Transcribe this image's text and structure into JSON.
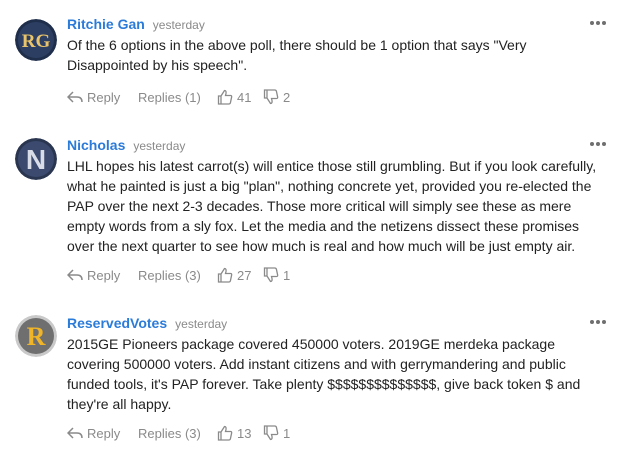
{
  "comments": [
    {
      "author": "Ritchie Gan",
      "time": "yesterday",
      "avatar_text": "RG",
      "text": "Of the 6 options in the above poll, there should be 1 option that says \"Very Disappointed by his speech\".",
      "reply_label": "Reply",
      "replies_label": "Replies (1)",
      "likes": "41",
      "dislikes": "2"
    },
    {
      "author": "Nicholas",
      "time": "yesterday",
      "avatar_text": "N",
      "text": "LHL hopes his latest carrot(s) will entice those still grumbling. But if you look carefully, what he painted is just a big \"plan\", nothing concrete yet, provided you re-elected the PAP over the next 2-3 decades. Those more critical will simply see these as mere empty words from a sly fox. Let the media and the netizens dissect these promises over the next quarter to see how much is real and how much will be just empty air.",
      "reply_label": "Reply",
      "replies_label": "Replies (3)",
      "likes": "27",
      "dislikes": "1"
    },
    {
      "author": "ReservedVotes",
      "time": "yesterday",
      "avatar_text": "R",
      "text": "2015GE Pioneers package covered 450000 voters. 2019GE merdeka package covering 500000 voters. Add instant citizens and with gerrymandering and public funded tools, it's PAP forever. Take plenty $$$$$$$$$$$$$$, give back token $ and they're all happy.",
      "reply_label": "Reply",
      "replies_label": "Replies (3)",
      "likes": "13",
      "dislikes": "1"
    }
  ],
  "colors": {
    "author": "#2b7bd9",
    "muted": "#8a8a8a",
    "text": "#222222"
  },
  "icons": [
    "reply-arrow-icon",
    "thumbs-up-icon",
    "thumbs-down-icon",
    "more-dots-icon"
  ]
}
